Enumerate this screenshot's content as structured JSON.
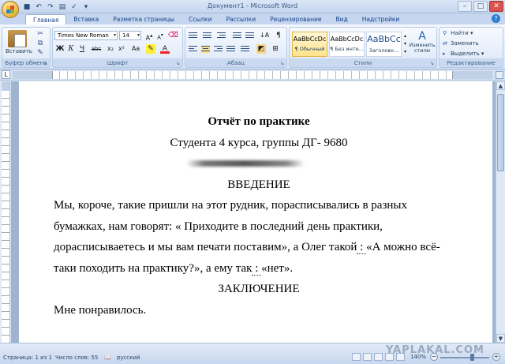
{
  "window": {
    "title": "Документ1 - Microsoft Word",
    "qat_icons": [
      "save-icon",
      "undo-icon",
      "redo-icon",
      "print-preview-icon",
      "spelling-icon",
      "customize-icon"
    ],
    "controls": [
      "–",
      "□",
      "✕"
    ]
  },
  "tabs": [
    {
      "label": "Главная",
      "active": true
    },
    {
      "label": "Вставка",
      "active": false
    },
    {
      "label": "Разметка страницы",
      "active": false
    },
    {
      "label": "Ссылки",
      "active": false
    },
    {
      "label": "Рассылки",
      "active": false
    },
    {
      "label": "Рецензирование",
      "active": false
    },
    {
      "label": "Вид",
      "active": false
    },
    {
      "label": "Надстройки",
      "active": false
    }
  ],
  "ribbon": {
    "clipboard": {
      "label": "Буфер обмена",
      "paste_label": "Вставить"
    },
    "font": {
      "label": "Шрифт",
      "font_name": "Times New Roman",
      "font_size": "14",
      "buttons": [
        "Ж",
        "К",
        "Ч",
        "abc",
        "x₂",
        "x²",
        "Aa",
        "A"
      ]
    },
    "paragraph": {
      "label": "Абзац"
    },
    "styles": {
      "label": "Стили",
      "items": [
        {
          "sample": "AaBbCcDc",
          "name": "¶ Обычный",
          "selected": true
        },
        {
          "sample": "AaBbCcDc",
          "name": "¶ Без инте...",
          "selected": false
        },
        {
          "sample": "AaBbCc",
          "name": "Заголово...",
          "selected": false
        }
      ],
      "change_styles_label": "Изменить стили"
    },
    "editing": {
      "label": "Редактирование",
      "find": "Найти",
      "replace": "Заменить",
      "select": "Выделить"
    }
  },
  "document": {
    "title": "Отчёт по практике",
    "subtitle": "Студента 4 курса, группы ДГ- 9680",
    "heading_intro": "ВВЕДЕНИЕ",
    "line1": "Мы, короче, такие пришли на этот рудник, порасписывались в разных",
    "line2": "бумажках, нам говорят: « Приходите в последний день практики,",
    "line3a": "дорасписываетесь и мы вам печати поставим», а Олег такой",
    "line3b": " : ",
    "line3c": "«А можно всё-",
    "line4a": "таки походить на практику?», а ему так",
    "line4b": " : ",
    "line4c": "«нет».",
    "heading_conclusion": "ЗАКЛЮЧЕНИЕ",
    "line5": "Мне понравилось."
  },
  "statusbar": {
    "page": "Страница: 1 из 1",
    "words": "Число слов: 55",
    "language": "русский",
    "zoom": "140%",
    "watermark": "YAPLAKAL.COM"
  }
}
